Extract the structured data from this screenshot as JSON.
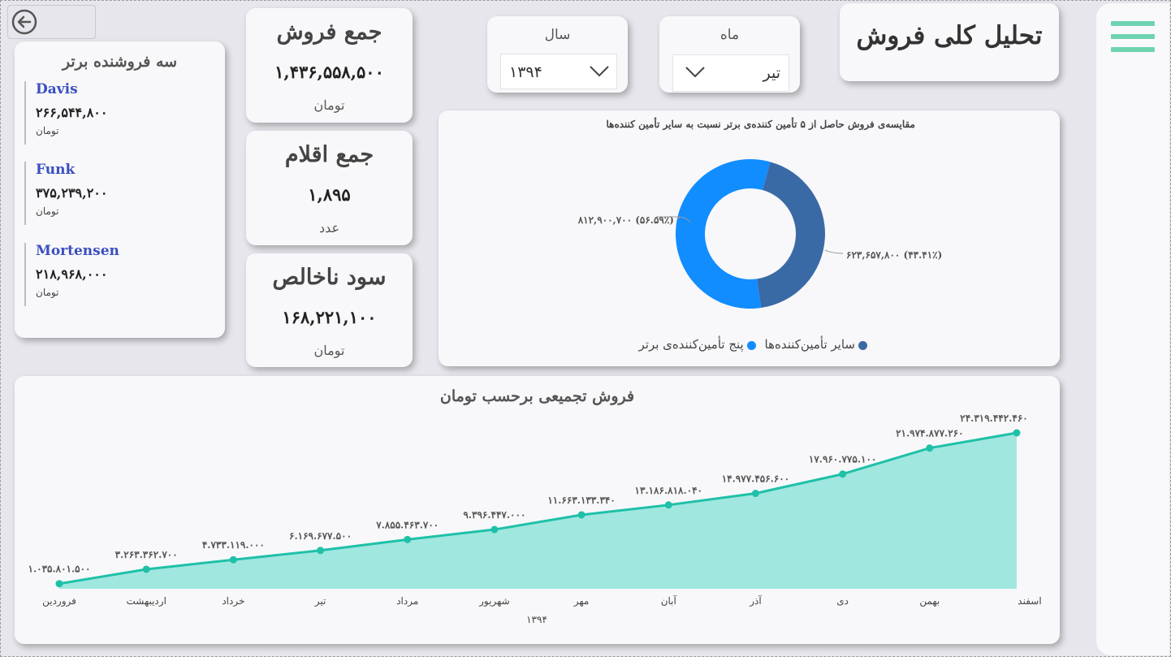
{
  "header": {
    "title": "تحلیل کلی فروش"
  },
  "nav": {
    "menu_icon": "hamburger-menu-icon",
    "back_icon": "back-arrow-icon",
    "accent": "#6fd3b0"
  },
  "filters": {
    "year": {
      "label": "سال",
      "value": "۱۳۹۴"
    },
    "month": {
      "label": "ماه",
      "value": "تیر"
    }
  },
  "kpis": {
    "total_sales": {
      "title": "جمع فروش",
      "value": "۱,۴۳۶,۵۵۸,۵۰۰",
      "unit": "تومان"
    },
    "total_items": {
      "title": "جمع اقلام",
      "value": "۱,۸۹۵",
      "unit": "عدد"
    },
    "gross_profit": {
      "title": "سود ناخالص",
      "value": "۱۶۸,۲۲۱,۱۰۰",
      "unit": "تومان"
    }
  },
  "top_sellers": {
    "title": "سه فروشنده برتر",
    "items": [
      {
        "name": "Davis",
        "value": "۲۶۶,۵۴۴,۸۰۰",
        "unit": "تومان"
      },
      {
        "name": "Funk",
        "value": "۳۷۵,۲۳۹,۲۰۰",
        "unit": "تومان"
      },
      {
        "name": "Mortensen",
        "value": "۲۱۸,۹۶۸,۰۰۰",
        "unit": "تومان"
      }
    ]
  },
  "chart_data": [
    {
      "type": "pie",
      "title": "مقایسه‌ی فروش حاصل از ۵ تأمین کننده‌ی برتر نسبت به سایر تأمین کننده‌ها",
      "donut": true,
      "categories": [
        "پنج تأمین‌کننده‌ی برتر",
        "سایر تأمین‌کننده‌ها"
      ],
      "values": [
        812900700,
        623657800
      ],
      "value_labels": [
        "۸۱۲,۹۰۰,۷۰۰ (۵۶.۵۹٪)",
        "۶۲۳,۶۵۷,۸۰۰ (۴۳.۴۱٪)"
      ],
      "percentages": [
        56.59,
        43.41
      ],
      "colors": [
        "#118dff",
        "#3a6aa6"
      ],
      "legend": "bottom"
    },
    {
      "type": "area",
      "title": "فروش تجمیعی برحسب تومان",
      "xlabel": "۱۳۹۴",
      "ylabel": "",
      "categories": [
        "فروردین",
        "اردیبهشت",
        "خرداد",
        "تیر",
        "مرداد",
        "شهریور",
        "مهر",
        "آبان",
        "آذر",
        "دی",
        "بهمن",
        "اسفند"
      ],
      "values": [
        1035801500,
        3263362700,
        4733119000,
        6169677500,
        7855463700,
        9396447000,
        11663133340,
        13186818040,
        14977456600,
        17960775100,
        21974877260,
        24319442460
      ],
      "data_labels": [
        "۱.۰۳۵.۸۰۱.۵۰۰",
        "۳.۲۶۳.۳۶۲.۷۰۰",
        "۴.۷۳۳.۱۱۹.۰۰۰",
        "۶.۱۶۹.۶۷۷.۵۰۰",
        "۷.۸۵۵.۴۶۳.۷۰۰",
        "۹.۳۹۶.۴۴۷.۰۰۰",
        "۱۱.۶۶۳.۱۳۳.۳۴۰",
        "۱۳.۱۸۶.۸۱۸.۰۴۰",
        "۱۴.۹۷۷.۴۵۶.۶۰۰",
        "۱۷.۹۶۰.۷۷۵.۱۰۰",
        "۲۱.۹۷۴.۸۷۷.۲۶۰",
        "۲۴.۳۱۹.۴۴۲.۴۶۰"
      ],
      "line_color": "#1fc0a8",
      "fill_color": "#a0e7e0",
      "grid": false
    }
  ]
}
